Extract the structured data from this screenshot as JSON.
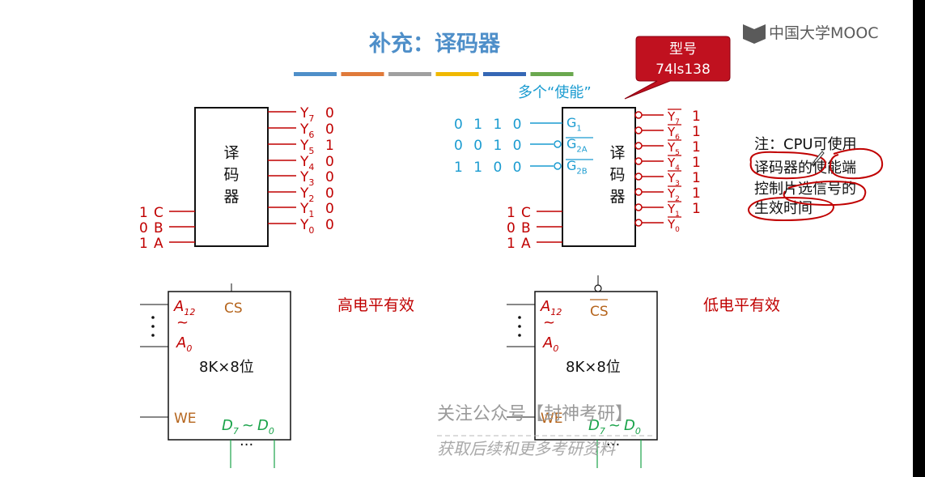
{
  "title": "补充：译码器",
  "logo": {
    "text": "中国大学MOOC"
  },
  "title_bar_colors": [
    "#4f8fc9",
    "#e07a3a",
    "#a0a0a0",
    "#f0b800",
    "#3567b5",
    "#6aa84f"
  ],
  "callout": {
    "line1": "型号",
    "line2": "74ls138"
  },
  "enable_note": "多个“使能”",
  "decoder_label": [
    "译",
    "码",
    "器"
  ],
  "left_decoder": {
    "outputs": [
      {
        "label": "Y",
        "sub": "7",
        "val": "0"
      },
      {
        "label": "Y",
        "sub": "6",
        "val": "0"
      },
      {
        "label": "Y",
        "sub": "5",
        "val": "1"
      },
      {
        "label": "Y",
        "sub": "4",
        "val": "0"
      },
      {
        "label": "Y",
        "sub": "3",
        "val": "0"
      },
      {
        "label": "Y",
        "sub": "2",
        "val": "0"
      },
      {
        "label": "Y",
        "sub": "1",
        "val": "0"
      },
      {
        "label": "Y",
        "sub": "0",
        "val": "0"
      }
    ],
    "inputs": [
      {
        "val": "1",
        "name": "C"
      },
      {
        "val": "0",
        "name": "B"
      },
      {
        "val": "1",
        "name": "A"
      }
    ]
  },
  "right_decoder": {
    "enables": [
      {
        "bits": "0 1 1 0",
        "name": "G",
        "sub": "1",
        "bar": false
      },
      {
        "bits": "0 0 1 0",
        "name": "G",
        "sub": "2A",
        "bar": true
      },
      {
        "bits": "1 1 0 0",
        "name": "G",
        "sub": "2B",
        "bar": true
      }
    ],
    "outputs": [
      {
        "label": "Y",
        "sub": "7",
        "val": "1"
      },
      {
        "label": "Y",
        "sub": "6",
        "val": "1"
      },
      {
        "label": "Y",
        "sub": "5",
        "val": "1"
      },
      {
        "label": "Y",
        "sub": "4",
        "val": "1"
      },
      {
        "label": "Y",
        "sub": "3",
        "val": "1"
      },
      {
        "label": "Y",
        "sub": "2",
        "val": "1"
      },
      {
        "label": "Y",
        "sub": "1",
        "val": "1"
      },
      {
        "label": "Y",
        "sub": "0",
        "val": ""
      }
    ],
    "inputs": [
      {
        "val": "1",
        "name": "C"
      },
      {
        "val": "0",
        "name": "B"
      },
      {
        "val": "1",
        "name": "A"
      }
    ]
  },
  "note": {
    "lines": [
      "注：CPU可使用",
      "译码器的使能端",
      "控制片选信号的",
      "生效时间"
    ]
  },
  "chips": {
    "addr_hi": "A",
    "addr_hi_sub": "12",
    "tilde": "~",
    "addr_lo": "A",
    "addr_lo_sub": "0",
    "cs": "CS",
    "capacity": "8K×8位",
    "we": "WE",
    "data_hi": "D",
    "data_hi_sub": "7",
    "data_tilde": "~",
    "data_lo": "D",
    "data_lo_sub": "0",
    "dots": "···"
  },
  "high_active": "高电平有效",
  "low_active": "低电平有效",
  "watermark": {
    "line1": "关注公众号【封神考研】",
    "line2": "获取后续和更多考研资料"
  }
}
